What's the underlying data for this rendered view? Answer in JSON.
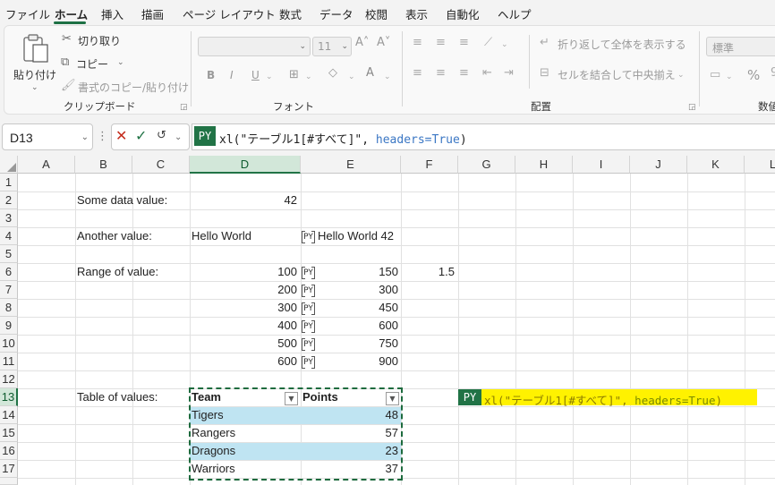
{
  "menu": [
    "ファイル",
    "ホーム",
    "挿入",
    "描画",
    "ページ レイアウト",
    "数式",
    "データ",
    "校閲",
    "表示",
    "自動化",
    "ヘルプ"
  ],
  "ribbon": {
    "clipboard": {
      "paste": "貼り付け",
      "cut": "切り取り",
      "copy": "コピー",
      "format_painter": "書式のコピー/貼り付け",
      "label": "クリップボード"
    },
    "font": {
      "size": "11",
      "bold": "B",
      "italic": "I",
      "underline": "U",
      "label": "フォント"
    },
    "alignment": {
      "wrap": "折り返して全体を表示する",
      "merge": "セルを結合して中央揃え",
      "label": "配置"
    },
    "number": {
      "format": "標準",
      "percent": "%",
      "label": "数値"
    }
  },
  "formula_bar": {
    "name_box": "D13",
    "py": "PY",
    "formula": "xl(\"テーブル1[#すべて]\", ",
    "formula_kw": "headers=True",
    "formula_end": ")"
  },
  "columns": [
    "A",
    "B",
    "C",
    "D",
    "E",
    "F",
    "G",
    "H",
    "I",
    "J",
    "K",
    "L"
  ],
  "rows": [
    "1",
    "2",
    "3",
    "4",
    "5",
    "6",
    "7",
    "8",
    "9",
    "10",
    "11",
    "12",
    "13",
    "14",
    "15",
    "16",
    "17"
  ],
  "cells": {
    "b2": "Some data value:",
    "d2": "42",
    "b4": "Another value:",
    "d4": "Hello World",
    "e4": "Hello World 42",
    "b6": "Range of value:",
    "f6": "1.5",
    "b13": "Table of values:"
  },
  "range_rows": [
    {
      "d": "100",
      "e": "150"
    },
    {
      "d": "200",
      "e": "300"
    },
    {
      "d": "300",
      "e": "450"
    },
    {
      "d": "400",
      "e": "600"
    },
    {
      "d": "500",
      "e": "750"
    },
    {
      "d": "600",
      "e": "900"
    }
  ],
  "table": {
    "headers": [
      "Team",
      "Points"
    ],
    "rows": [
      [
        "Tigers",
        "48"
      ],
      [
        "Rangers",
        "57"
      ],
      [
        "Dragons",
        "23"
      ],
      [
        "Warriors",
        "37"
      ]
    ],
    "colors": {
      "band": "#bfe4f2",
      "border": "#1e6b3e"
    }
  },
  "py_cell": {
    "badge": "PY",
    "formula": "xl(\"テーブル1[#すべて]\", ",
    "kw": "headers=True",
    "end": ")"
  },
  "colors": {
    "accent": "#217346",
    "highlight": "#fff200"
  }
}
